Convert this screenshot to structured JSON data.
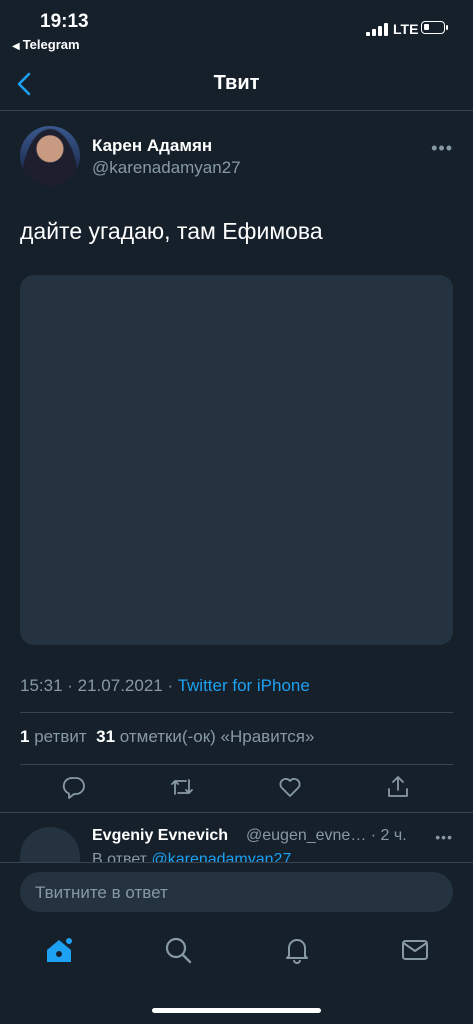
{
  "status_bar": {
    "time": "19:13",
    "back_app": "Telegram",
    "network": "LTE"
  },
  "nav": {
    "title": "Твит"
  },
  "tweet": {
    "author_name": "Карен Адамян",
    "author_handle": "@karenadamyan27",
    "text": "дайте угадаю, там Ефимова",
    "time": "15:31",
    "date": "21.07.2021",
    "source": "Twitter for iPhone",
    "retweets_count": "1",
    "retweets_label": "ретвит",
    "likes_count": "31",
    "likes_label": "отметки(-ок) «Нравится»"
  },
  "reply": {
    "name": "Evgeniy Evnevich",
    "handle": "@eugen_evne…",
    "time": "· 2 ч.",
    "reply_to_label": "В ответ",
    "reply_to_handle": "@karenadamyan27"
  },
  "compose": {
    "placeholder": "Твитните в ответ"
  },
  "tabs": [
    "home-icon",
    "search-icon",
    "notifications-icon",
    "messages-icon"
  ],
  "colors": {
    "background": "#15202b",
    "accent": "#1da1f2",
    "secondary_text": "#8899a6",
    "surface": "#253341"
  }
}
